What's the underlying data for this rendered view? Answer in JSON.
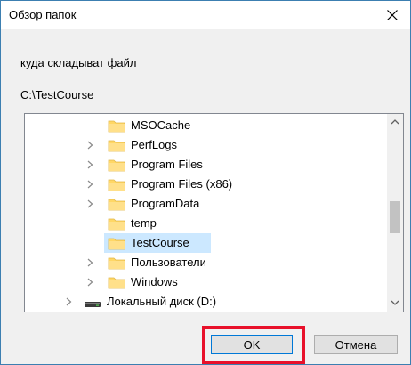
{
  "window": {
    "title": "Обзор папок",
    "close_icon": "close-icon"
  },
  "prompt": "куда складыват файл",
  "path": "C:\\TestCourse",
  "tree": {
    "items": [
      {
        "label": "MSOCache",
        "expandable": false,
        "selected": false,
        "icon": "folder-icon"
      },
      {
        "label": "PerfLogs",
        "expandable": true,
        "selected": false,
        "icon": "folder-icon"
      },
      {
        "label": "Program Files",
        "expandable": true,
        "selected": false,
        "icon": "folder-icon"
      },
      {
        "label": "Program Files (x86)",
        "expandable": true,
        "selected": false,
        "icon": "folder-icon"
      },
      {
        "label": "ProgramData",
        "expandable": true,
        "selected": false,
        "icon": "folder-icon"
      },
      {
        "label": "temp",
        "expandable": false,
        "selected": false,
        "icon": "folder-icon"
      },
      {
        "label": "TestCourse",
        "expandable": false,
        "selected": true,
        "icon": "folder-icon"
      },
      {
        "label": "Пользователи",
        "expandable": true,
        "selected": false,
        "icon": "folder-icon"
      },
      {
        "label": "Windows",
        "expandable": true,
        "selected": false,
        "icon": "folder-icon"
      },
      {
        "label": "Локальный диск (D:)",
        "expandable": true,
        "selected": false,
        "icon": "drive-icon"
      }
    ]
  },
  "buttons": {
    "ok_label": "OK",
    "cancel_label": "Отмена"
  },
  "colors": {
    "selection": "#cce8ff",
    "folder": "#ffd766",
    "highlight": "#e8102a",
    "accent": "#0078d7"
  }
}
